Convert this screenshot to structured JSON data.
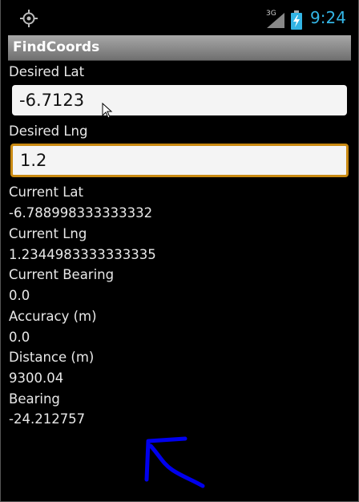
{
  "status_bar": {
    "gps_icon": "gps-crosshair-icon",
    "signal_label": "3G",
    "signal_icon": "signal-strength-icon",
    "battery_icon": "battery-charging-icon",
    "time": "9:24",
    "accent_color": "#33b5e5"
  },
  "app": {
    "title": "FindCoords"
  },
  "form": {
    "desired_lat_label": "Desired Lat",
    "desired_lat_value": "-6.7123",
    "desired_lng_label": "Desired Lng",
    "desired_lng_value": "1.2",
    "focus_color": "#c98a12"
  },
  "readouts": {
    "current_lat_label": "Current Lat",
    "current_lat_value": "-6.788998333333332",
    "current_lng_label": "Current Lng",
    "current_lng_value": "1.2344983333333335",
    "current_bearing_label": "Current Bearing",
    "current_bearing_value": "0.0",
    "accuracy_label": "Accuracy (m)",
    "accuracy_value": "0.0",
    "distance_label": "Distance (m)",
    "distance_value": "9300.04",
    "bearing_label": "Bearing",
    "bearing_value": "-24.212757"
  },
  "direction_arrow": {
    "icon": "direction-arrow-icon",
    "color": "#0000ee"
  },
  "mouse_cursor": {
    "icon": "mouse-pointer-icon"
  }
}
